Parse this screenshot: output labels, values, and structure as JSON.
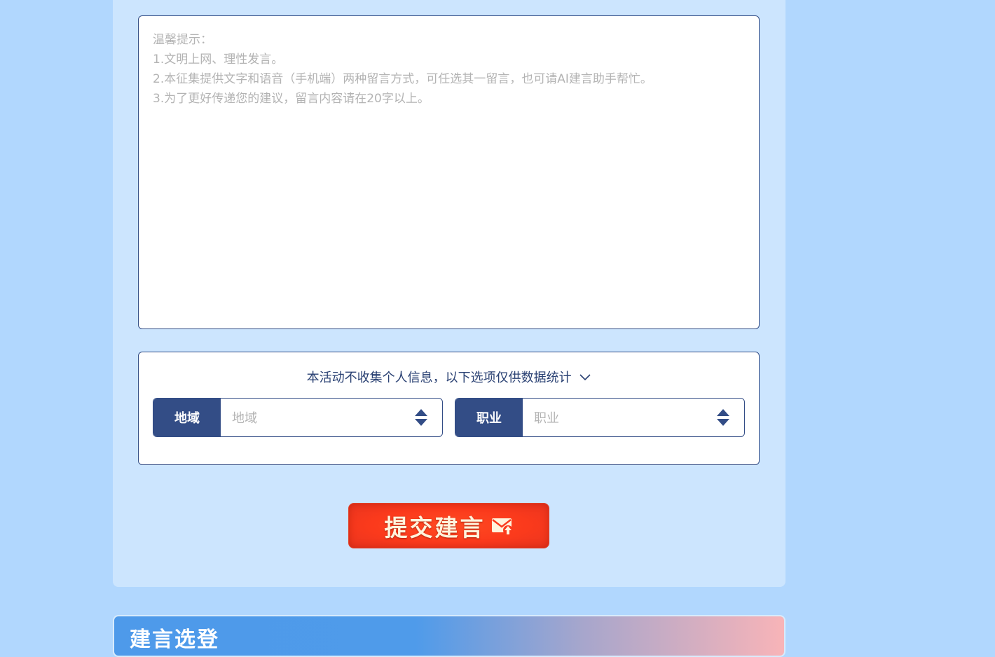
{
  "message": {
    "hint_lines": [
      "温馨提示：",
      "1.文明上网、理性发言。",
      "2.本征集提供文字和语音（手机端）两种留言方式，可任选其一留言，也可请AI建言助手帮忙。",
      "3.为了更好传递您的建议，留言内容请在20字以上。"
    ],
    "value": ""
  },
  "stats": {
    "notice": "本活动不收集个人信息，以下选项仅供数据统计",
    "region": {
      "label": "地域",
      "placeholder": "地域"
    },
    "occupation": {
      "label": "职业",
      "placeholder": "职业"
    }
  },
  "submit": {
    "label": "提交建言",
    "icon": "mail-upload-icon"
  },
  "section": {
    "title": "建言选登"
  },
  "colors": {
    "page_bg": "#b1d7fe",
    "panel_bg": "#cce5fe",
    "accent": "#334d86",
    "submit": "#fb3a1c"
  }
}
